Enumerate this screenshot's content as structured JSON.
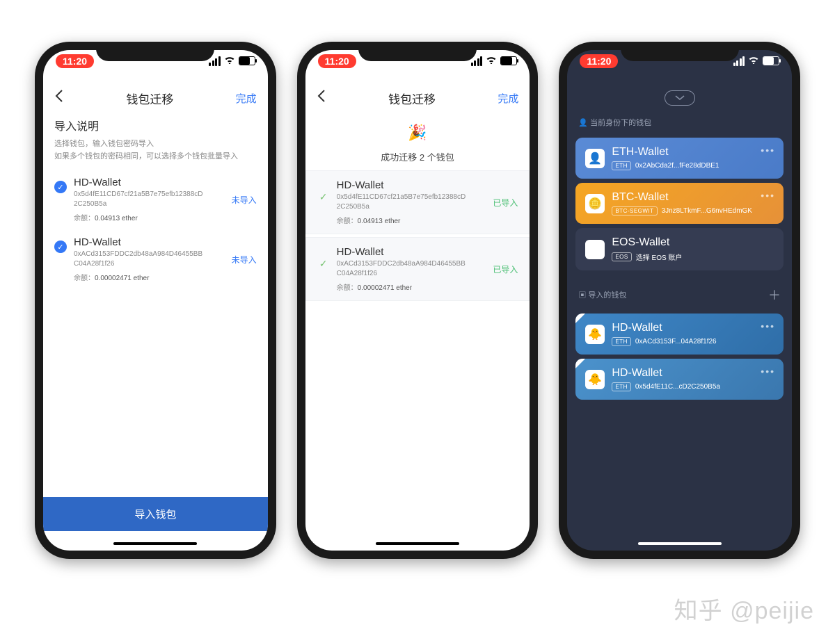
{
  "watermark": "知乎 @peijie",
  "status": {
    "time": "11:20"
  },
  "screen1": {
    "nav": {
      "title": "钱包迁移",
      "done": "完成"
    },
    "desc": {
      "heading": "导入说明",
      "line1": "选择钱包，输入钱包密码导入",
      "line2": "如果多个钱包的密码相同，可以选择多个钱包批量导入"
    },
    "wallets": [
      {
        "name": "HD-Wallet",
        "addr": "0x5d4fE11CD67cf21a5B7e75efb12388cD2C250B5a",
        "balance_label": "余额：",
        "balance_value": "0.04913 ether",
        "status": "未导入"
      },
      {
        "name": "HD-Wallet",
        "addr": "0xACd3153FDDC2db48aA984D46455BBC04A28f1f26",
        "balance_label": "余额：",
        "balance_value": "0.00002471 ether",
        "status": "未导入"
      }
    ],
    "import_button": "导入钱包"
  },
  "screen2": {
    "nav": {
      "title": "钱包迁移",
      "done": "完成"
    },
    "confetti": "🎉",
    "success": "成功迁移 2 个钱包",
    "wallets": [
      {
        "name": "HD-Wallet",
        "addr": "0x5d4fE11CD67cf21a5B7e75efb12388cD2C250B5a",
        "balance_label": "余额：",
        "balance_value": "0.04913 ether",
        "status": "已导入"
      },
      {
        "name": "HD-Wallet",
        "addr": "0xACd3153FDDC2db48aA984D46455BBC04A28f1f26",
        "balance_label": "余额：",
        "balance_value": "0.00002471 ether",
        "status": "已导入"
      }
    ]
  },
  "screen3": {
    "section1_label": "当前身份下的钱包",
    "wallets_identity": [
      {
        "name": "ETH-Wallet",
        "tag": "ETH",
        "addr": "0x2AbCda2f...fFe28dDBE1",
        "color": "eth"
      },
      {
        "name": "BTC-Wallet",
        "tag": "BTC-SEGWIT",
        "addr": "3Jnz8LTkmF...G6nvHEdmGK",
        "color": "btc"
      },
      {
        "name": "EOS-Wallet",
        "tag": "EOS",
        "addr": "选择 EOS 账户",
        "color": "eos"
      }
    ],
    "section2_label": "导入的钱包",
    "wallets_imported": [
      {
        "name": "HD-Wallet",
        "tag": "ETH",
        "addr": "0xACd3153F...04A28f1f26"
      },
      {
        "name": "HD-Wallet",
        "tag": "ETH",
        "addr": "0x5d4fE11C...cD2C250B5a"
      }
    ]
  }
}
